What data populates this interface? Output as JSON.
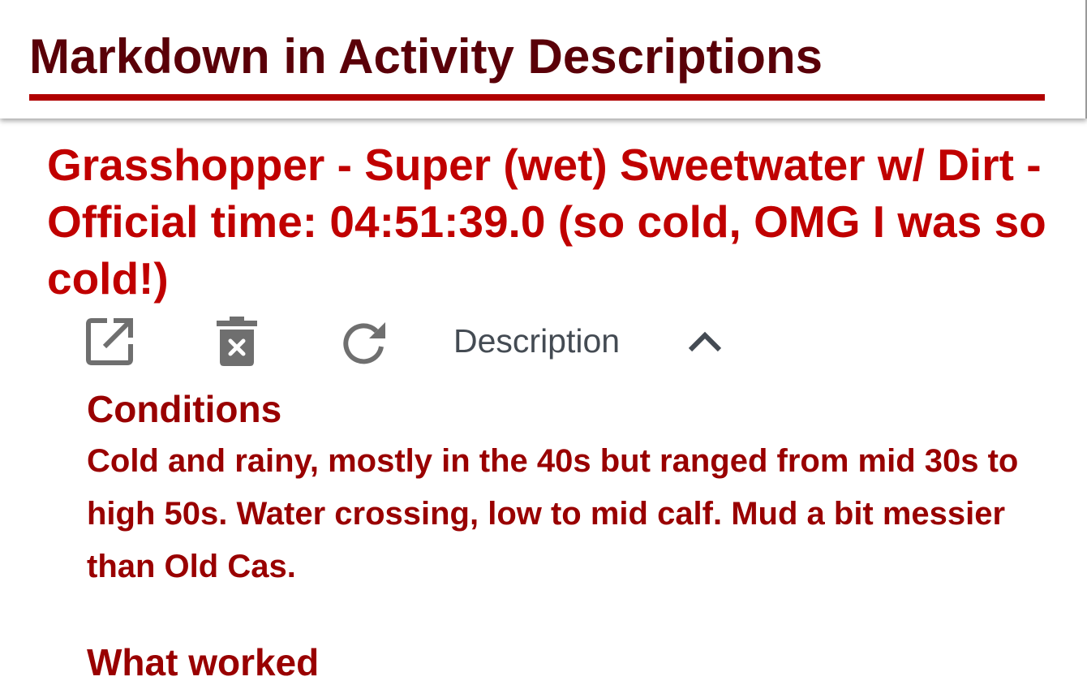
{
  "header": {
    "title": "Markdown in Activity Descriptions"
  },
  "activity": {
    "title": "Grasshopper - Super (wet) Sweetwater w/ Dirt - Official time: 04:51:39.0 (so cold, OMG I was so cold!)"
  },
  "toolbar": {
    "icons": [
      "open-in-new-icon",
      "delete-icon",
      "refresh-icon",
      "chevron-up-icon"
    ],
    "description_label": "Description"
  },
  "description": {
    "sections": [
      {
        "heading": "Conditions",
        "body": "Cold and rainy, mostly in the 40s but ranged from mid 30s to high 50s. Water crossing, low to mid calf. Mud a bit messier than Old Cas."
      },
      {
        "heading": "What worked"
      }
    ]
  },
  "colors": {
    "header_text": "#5a0008",
    "accent_red": "#b00000",
    "title_red": "#c00000",
    "body_red": "#990000",
    "icon_gray": "#6f6f6f",
    "label_gray": "#444b53"
  }
}
